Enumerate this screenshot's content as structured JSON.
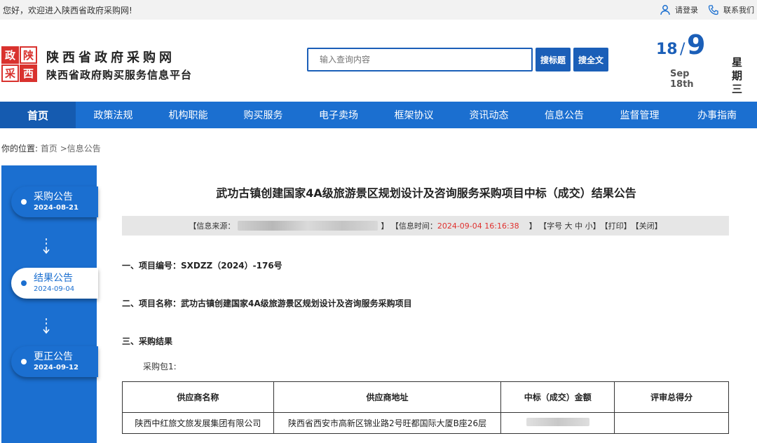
{
  "topbar": {
    "welcome": "您好，欢迎进入陕西省政府采购网!",
    "login": "请登录",
    "contact": "联系我们"
  },
  "header": {
    "logo_chars": [
      "政",
      "陕",
      "采",
      "西"
    ],
    "title": "陕西省政府采购网",
    "subtitle": "陕西省政府购买服务信息平台",
    "search_placeholder": "输入查询内容",
    "search_title_btn": "搜标题",
    "search_full_btn": "搜全文",
    "date_day": "18",
    "date_slash": "/",
    "date_month": "9",
    "date_en": "Sep 18th",
    "weekday": "星期三"
  },
  "nav": {
    "items": [
      "首页",
      "政策法规",
      "机构职能",
      "购买服务",
      "电子卖场",
      "框架协议",
      "资讯动态",
      "信息公告",
      "监督管理",
      "办事指南"
    ]
  },
  "breadcrumb": {
    "label": "你的位置:",
    "path": "首页 >信息公告"
  },
  "sidebar": {
    "items": [
      {
        "title": "采购公告",
        "date": "2024-08-21"
      },
      {
        "title": "结果公告",
        "date": "2024-09-04"
      },
      {
        "title": "更正公告",
        "date": "2024-09-12"
      }
    ]
  },
  "article": {
    "title": "武功古镇创建国家4A级旅游景区规划设计及咨询服务采购项目中标（成交）结果公告",
    "info_source_label": "【信息来源：",
    "info_time_label": "】 【信息时间：",
    "info_time": "2024-09-04 16:16:38",
    "info_font": "】 【字号 大 中 小】",
    "info_print": "【打印】",
    "info_close": "【关闭】",
    "section1": "一、项目编号：SXDZZ（2024）-176号",
    "section2": "二、项目名称：武功古镇创建国家4A级旅游景区规划设计及咨询服务采购项目",
    "section3": "三、采购结果",
    "package": "采购包1:",
    "table_headers": [
      "供应商名称",
      "供应商地址",
      "中标（成交）金额",
      "评审总得分"
    ],
    "table_row": [
      "陕西中红旅文旅发展集团有限公司",
      "陕西省西安市高新区锦业路2号旺都国际大厦B座26层",
      "",
      ""
    ]
  },
  "colors": {
    "brand_blue": "#1b6fd0",
    "logo_red": "#d9322e",
    "time_red": "#e0312f"
  }
}
